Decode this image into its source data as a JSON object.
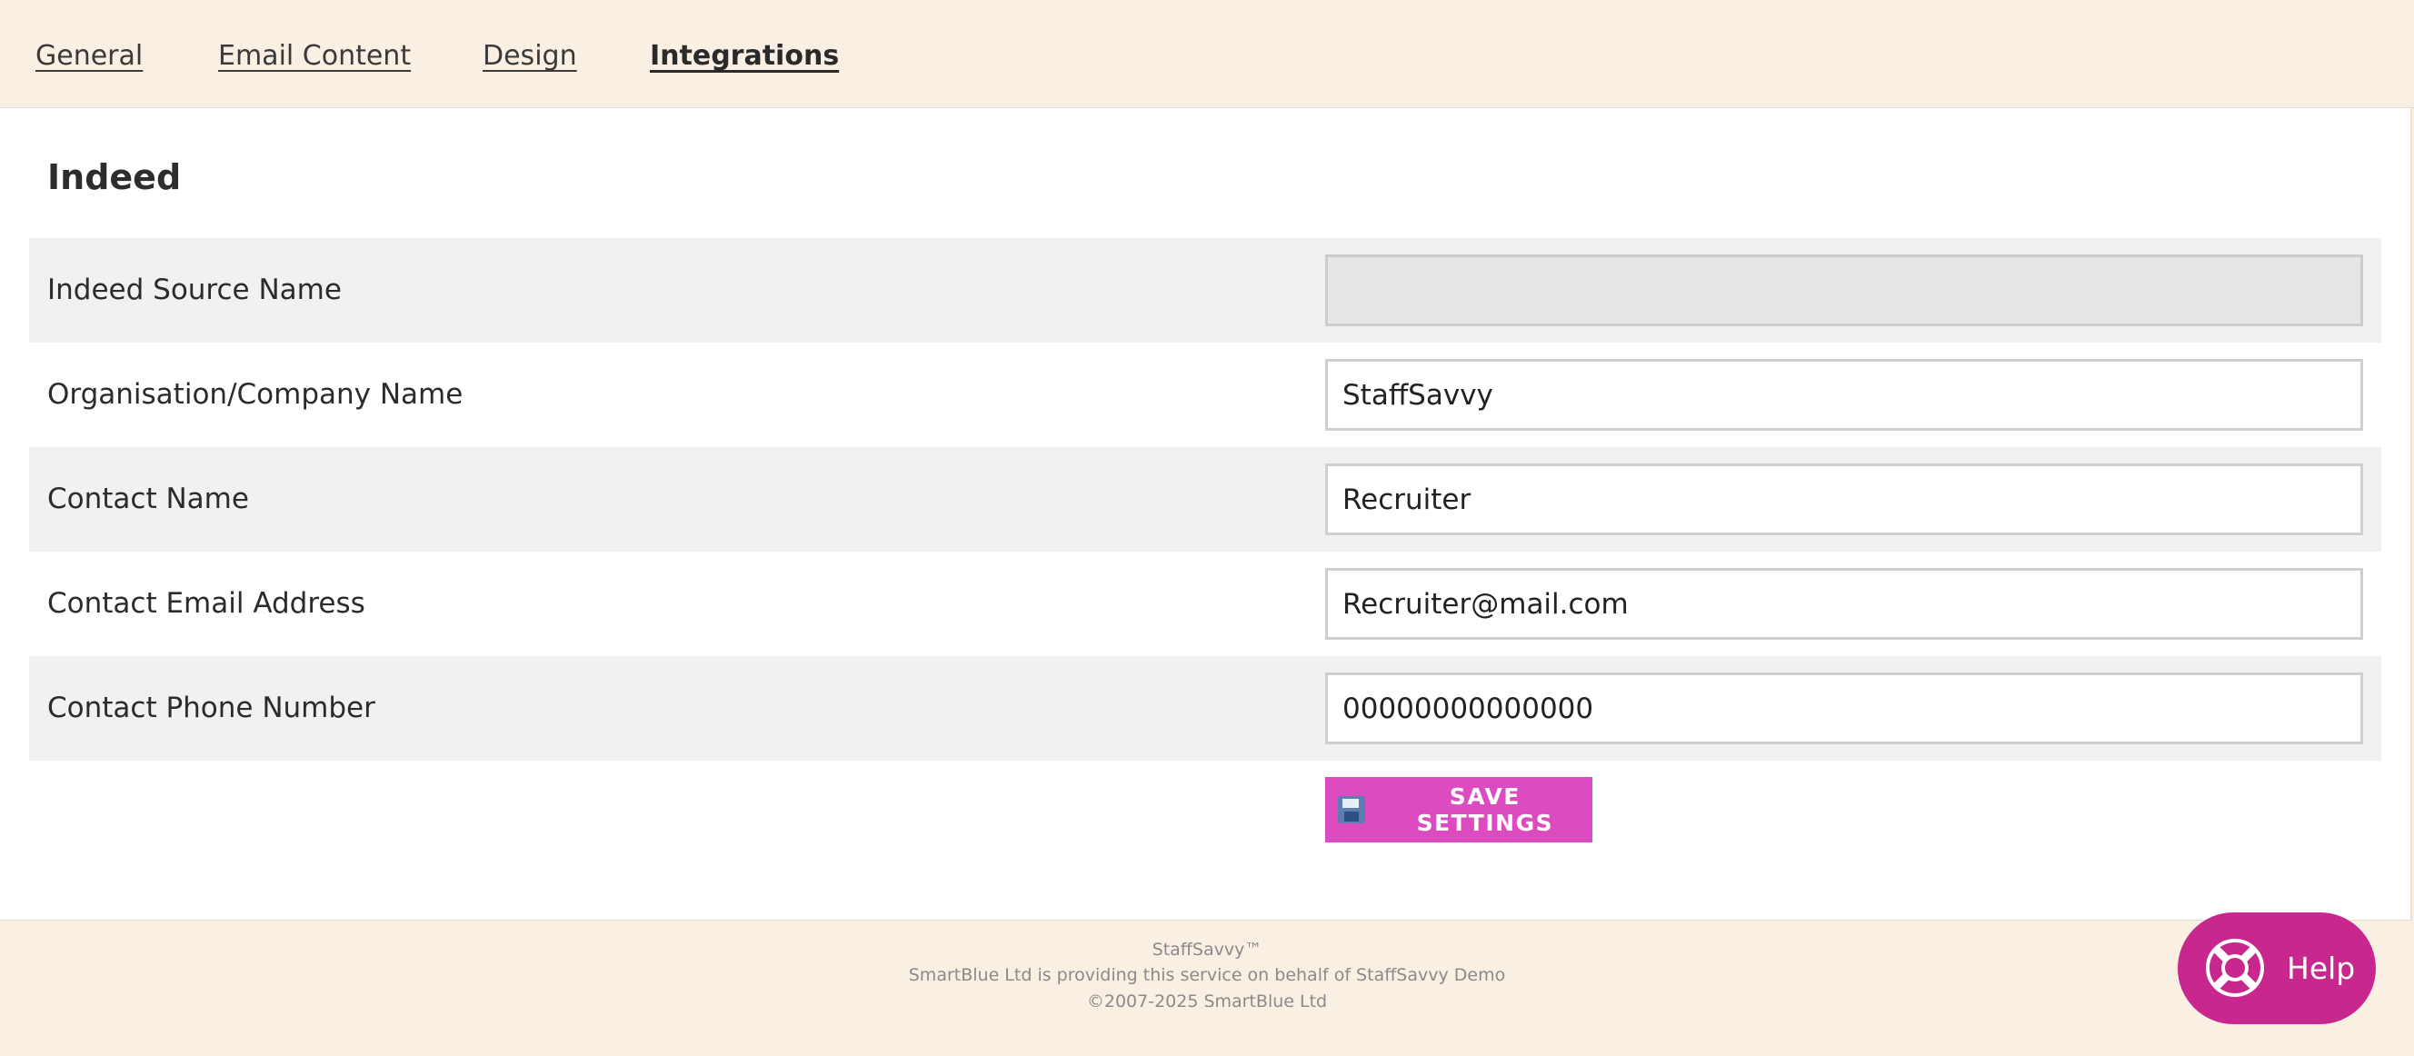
{
  "tabs": [
    {
      "label": "General"
    },
    {
      "label": "Email Content"
    },
    {
      "label": "Design"
    },
    {
      "label": "Integrations",
      "active": true
    }
  ],
  "section": {
    "title": "Indeed",
    "fields": [
      {
        "label": "Indeed Source Name",
        "value": "",
        "disabled": true
      },
      {
        "label": "Organisation/Company Name",
        "value": "StaffSavvy"
      },
      {
        "label": "Contact Name",
        "value": "Recruiter"
      },
      {
        "label": "Contact Email Address",
        "value": "Recruiter@mail.com"
      },
      {
        "label": "Contact Phone Number",
        "value": "00000000000000"
      }
    ],
    "save_label": "SAVE SETTINGS",
    "save_icon": "floppy-disk-icon"
  },
  "footer": {
    "brand": "StaffSavvy™",
    "provider": "SmartBlue Ltd is providing this service on behalf of StaffSavvy Demo",
    "copyright": "©2007-2025 SmartBlue Ltd"
  },
  "help": {
    "label": "Help",
    "icon": "lifebuoy-icon"
  },
  "colors": {
    "header_bg": "#f9f0e3",
    "accent_button": "#dd4bc0",
    "help_button": "#c8288e",
    "row_alt": "#f1f1f1"
  }
}
